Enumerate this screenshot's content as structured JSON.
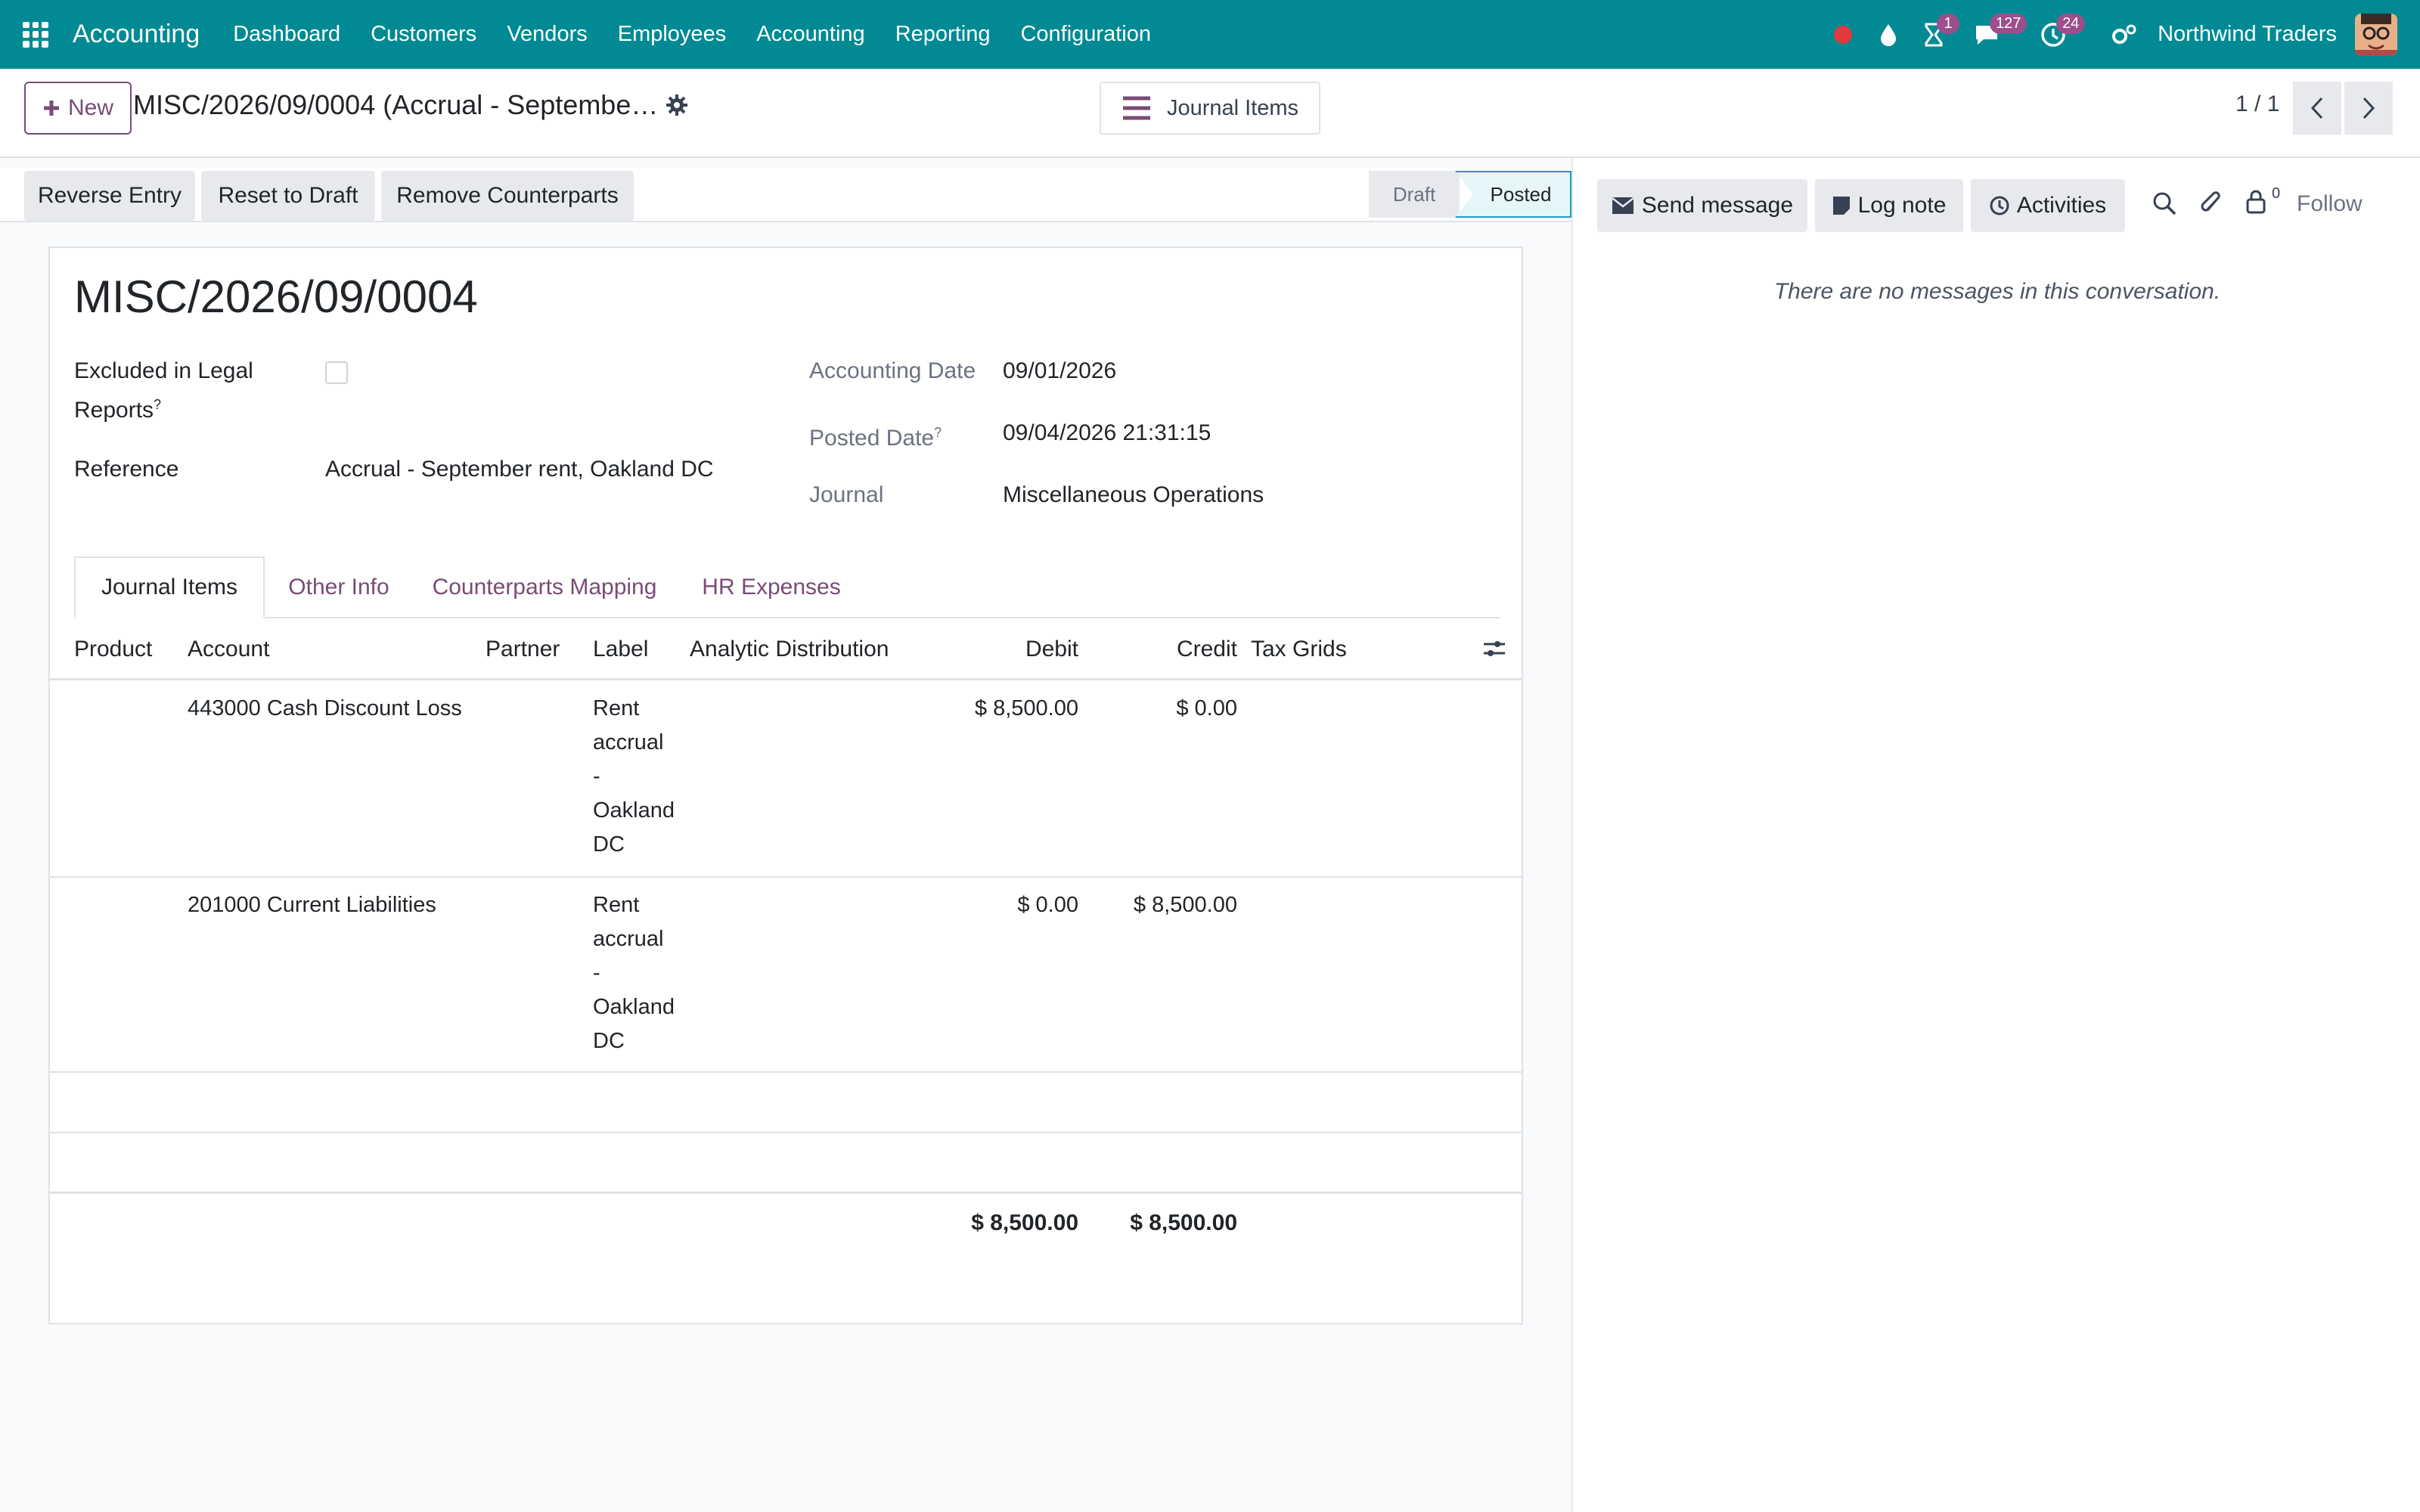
{
  "navbar": {
    "app_name": "Accounting",
    "menu": [
      "Dashboard",
      "Customers",
      "Vendors",
      "Employees",
      "Accounting",
      "Reporting",
      "Configuration"
    ],
    "badges": {
      "activity": "1",
      "messages": "127",
      "timer": "24"
    },
    "company": "Northwind Traders",
    "colors": {
      "bar": "#018a93",
      "badge": "#9b4f8c"
    }
  },
  "control": {
    "new_label": "New",
    "breadcrumb": "MISC/2026/09/0004 (Accrual - Septembe…",
    "smart_button": "Journal Items",
    "pager": "1 / 1"
  },
  "statusbar": {
    "actions": [
      "Reverse Entry",
      "Reset to Draft",
      "Remove Counterparts"
    ],
    "stages": {
      "draft": "Draft",
      "posted": "Posted"
    }
  },
  "form": {
    "title": "MISC/2026/09/0004",
    "excluded_label_line1": "Excluded in Legal",
    "excluded_label_line2": "Reports",
    "tooltip_mark": "?",
    "reference_label": "Reference",
    "reference_value": "Accrual - September rent, Oakland DC",
    "accounting_date_label": "Accounting Date",
    "accounting_date_value": "09/01/2026",
    "posted_date_label": "Posted Date",
    "posted_date_value": "09/04/2026 21:31:15",
    "journal_label": "Journal",
    "journal_value": "Miscellaneous Operations"
  },
  "tabs": [
    "Journal Items",
    "Other Info",
    "Counterparts Mapping",
    "HR Expenses"
  ],
  "table": {
    "columns": [
      "Product",
      "Account",
      "Partner",
      "Label",
      "Analytic Distribution",
      "Debit",
      "Credit",
      "Tax Grids"
    ],
    "rows": [
      {
        "product": "",
        "account": "443000 Cash Discount Loss",
        "partner": "",
        "label": [
          "Rent",
          "accrual",
          "-",
          "Oakland",
          "DC"
        ],
        "debit": "$ 8,500.00",
        "credit": "$ 0.00"
      },
      {
        "product": "",
        "account": "201000 Current Liabilities",
        "partner": "",
        "label": [
          "Rent",
          "accrual",
          "-",
          "Oakland",
          "DC"
        ],
        "debit": "$ 0.00",
        "credit": "$ 8,500.00"
      }
    ],
    "total_debit": "$ 8,500.00",
    "total_credit": "$ 8,500.00"
  },
  "chatter": {
    "send_message": "Send message",
    "log_note": "Log note",
    "activities": "Activities",
    "followers_count": "0",
    "follow": "Follow",
    "empty_text": "There are no messages in this conversation."
  }
}
